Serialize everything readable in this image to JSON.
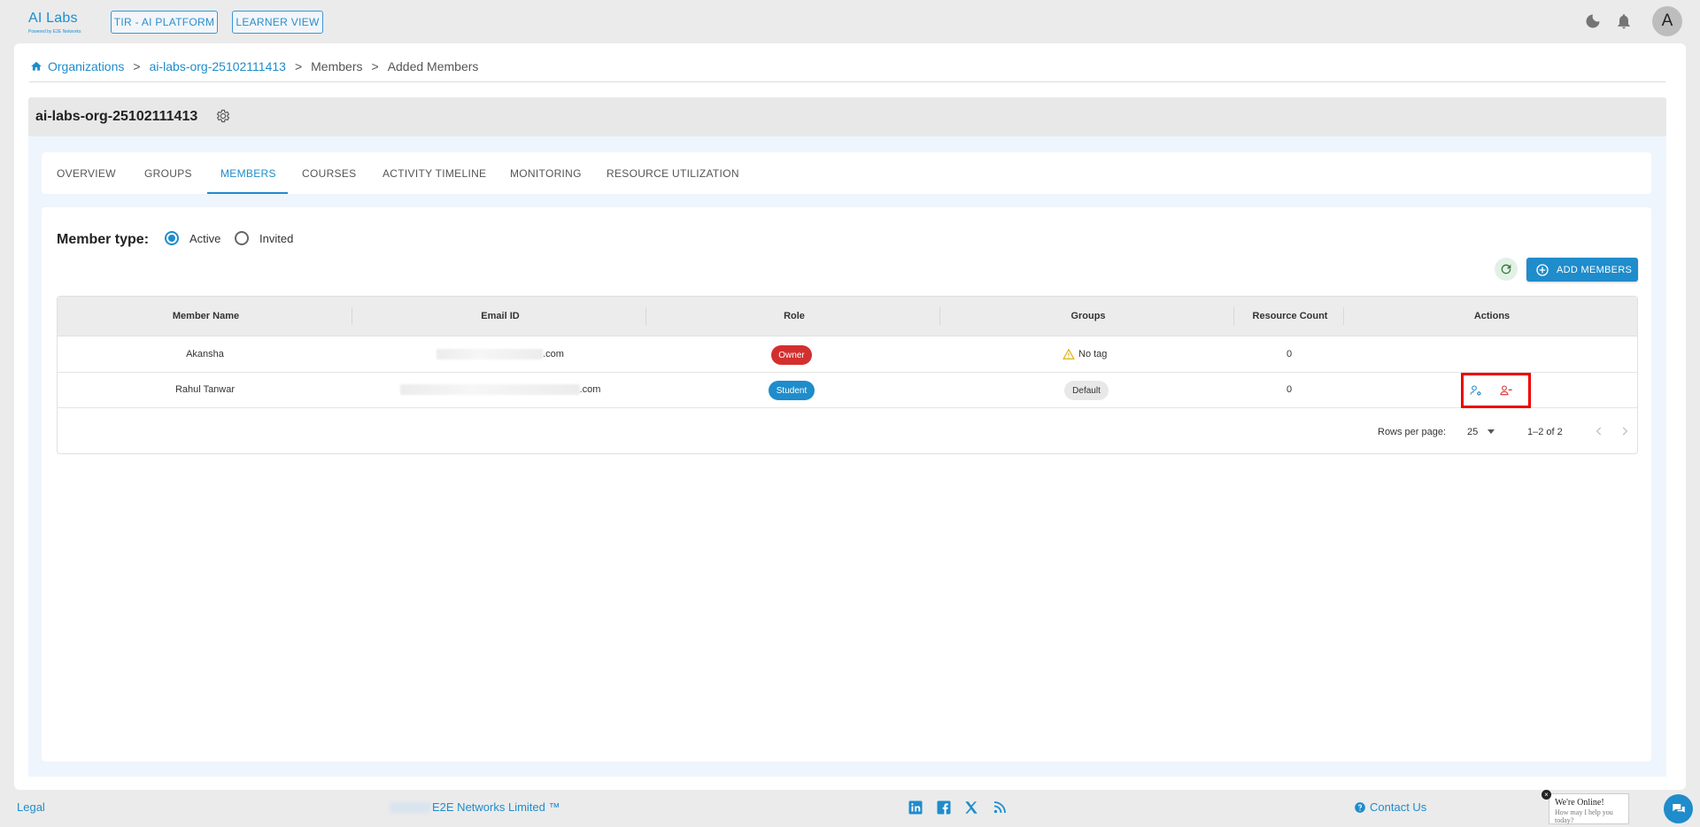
{
  "header": {
    "logo_text": "AI Labs",
    "logo_subtext": "Powered by E2E Networks",
    "tir_button": "TIR - AI PLATFORM",
    "learner_button": "LEARNER VIEW",
    "avatar_initial": "A"
  },
  "breadcrumb": {
    "items": [
      "Organizations",
      "ai-labs-org-25102111413",
      "Members",
      "Added Members"
    ],
    "separator": ">"
  },
  "org": {
    "title": "ai-labs-org-25102111413"
  },
  "tabs": [
    {
      "label": "OVERVIEW"
    },
    {
      "label": "GROUPS"
    },
    {
      "label": "MEMBERS"
    },
    {
      "label": "COURSES"
    },
    {
      "label": "ACTIVITY TIMELINE"
    },
    {
      "label": "MONITORING"
    },
    {
      "label": "RESOURCE UTILIZATION"
    }
  ],
  "active_tab": "MEMBERS",
  "member_type": {
    "label": "Member type:",
    "options": [
      "Active",
      "Invited"
    ],
    "selected": "Active"
  },
  "actions": {
    "add_members": "ADD MEMBERS"
  },
  "table": {
    "columns": [
      "Member Name",
      "Email ID",
      "Role",
      "Groups",
      "Resource Count",
      "Actions"
    ],
    "rows": [
      {
        "name": "Akansha",
        "email_suffix": ".com",
        "role": "Owner",
        "groups": "No tag",
        "resource_count": "0"
      },
      {
        "name": "Rahul Tanwar",
        "email_suffix": ".com",
        "role": "Student",
        "groups": "Default",
        "resource_count": "0"
      }
    ]
  },
  "pagination": {
    "rows_per_page_label": "Rows per page:",
    "rows_per_page": "25",
    "range": "1–2 of 2"
  },
  "footer": {
    "legal": "Legal",
    "copyright": "E2E Networks Limited ™",
    "contact": "Contact Us"
  },
  "chat": {
    "title": "We're Online!",
    "subtitle": "How may I help you today?"
  },
  "colors": {
    "accent": "#1f8ccb",
    "owner": "#d32f2f",
    "highlight": "#ee0000"
  }
}
